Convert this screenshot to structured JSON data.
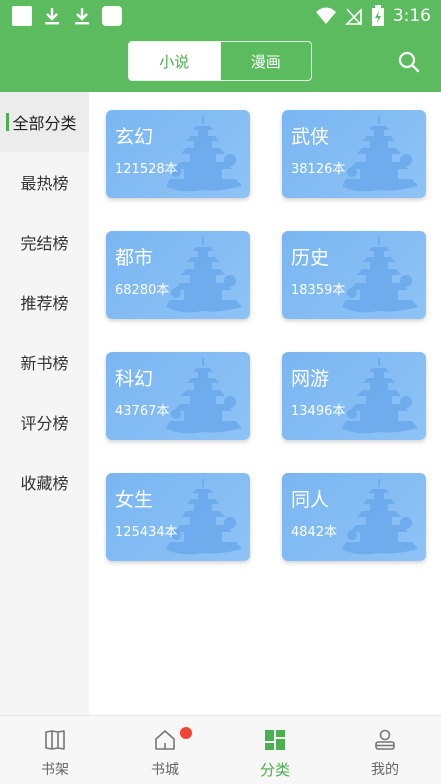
{
  "status_bar": {
    "time": "3:16"
  },
  "header": {
    "tabs": [
      {
        "label": "小说",
        "active": true
      },
      {
        "label": "漫画",
        "active": false
      }
    ],
    "accent_color": "#5cbb5f"
  },
  "sidebar": {
    "items": [
      {
        "label": "全部分类",
        "active": true
      },
      {
        "label": "最热榜",
        "active": false
      },
      {
        "label": "完结榜",
        "active": false
      },
      {
        "label": "推荐榜",
        "active": false
      },
      {
        "label": "新书榜",
        "active": false
      },
      {
        "label": "评分榜",
        "active": false
      },
      {
        "label": "收藏榜",
        "active": false
      }
    ]
  },
  "categories": [
    {
      "name": "玄幻",
      "count": "121528本"
    },
    {
      "name": "武侠",
      "count": "38126本"
    },
    {
      "name": "都市",
      "count": "68280本"
    },
    {
      "name": "历史",
      "count": "18359本"
    },
    {
      "name": "科幻",
      "count": "43767本"
    },
    {
      "name": "网游",
      "count": "13496本"
    },
    {
      "name": "女生",
      "count": "125434本"
    },
    {
      "name": "同人",
      "count": "4842本"
    }
  ],
  "bottom_nav": {
    "items": [
      {
        "label": "书架",
        "icon": "bookshelf-icon",
        "active": false
      },
      {
        "label": "书城",
        "icon": "home-icon",
        "active": false,
        "badge": true
      },
      {
        "label": "分类",
        "icon": "category-icon",
        "active": true
      },
      {
        "label": "我的",
        "icon": "profile-icon",
        "active": false
      }
    ]
  }
}
